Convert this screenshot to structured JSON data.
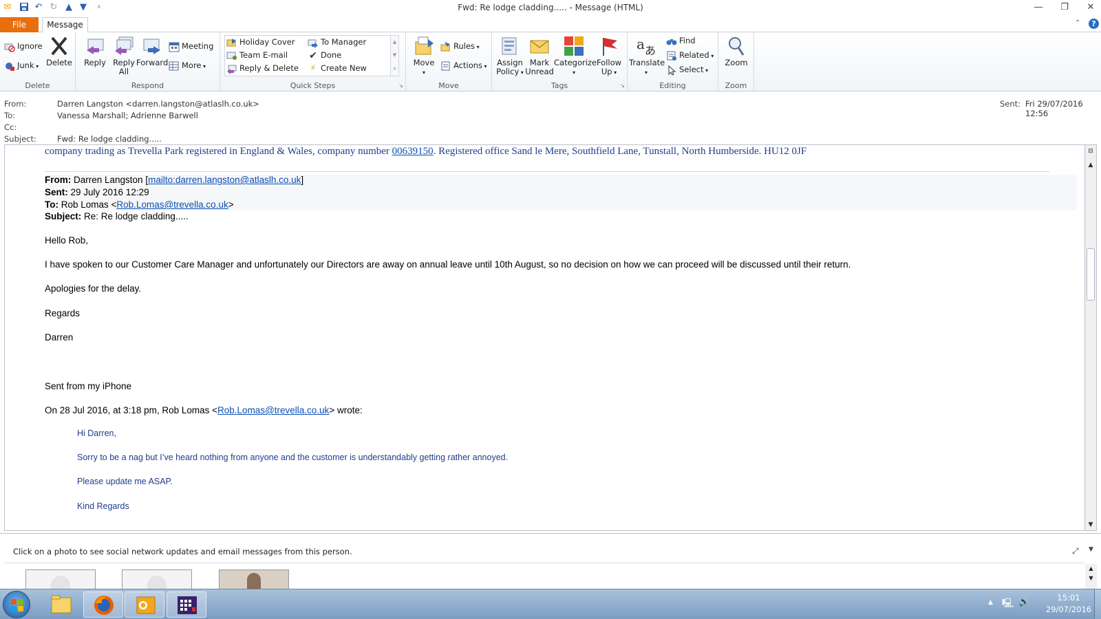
{
  "window": {
    "title": "Fwd: Re lodge cladding.....  -  Message (HTML)"
  },
  "tabs": {
    "file": "File",
    "message": "Message"
  },
  "ribbon": {
    "delete_group": {
      "label": "Delete",
      "ignore": "Ignore",
      "junk": "Junk",
      "delete": "Delete"
    },
    "respond_group": {
      "label": "Respond",
      "reply": "Reply",
      "reply_all_1": "Reply",
      "reply_all_2": "All",
      "forward": "Forward",
      "meeting": "Meeting",
      "more": "More"
    },
    "quicksteps_group": {
      "label": "Quick Steps",
      "items": [
        "Holiday Cover",
        "To Manager",
        "Team E-mail",
        "Done",
        "Reply & Delete",
        "Create New"
      ]
    },
    "move_group": {
      "label": "Move",
      "move": "Move",
      "rules": "Rules",
      "actions": "Actions"
    },
    "tags_group": {
      "label": "Tags",
      "assign_1": "Assign",
      "assign_2": "Policy",
      "mark_1": "Mark",
      "mark_2": "Unread",
      "categorize": "Categorize",
      "follow_1": "Follow",
      "follow_2": "Up"
    },
    "editing_group": {
      "label": "Editing",
      "translate": "Translate",
      "find": "Find",
      "related": "Related",
      "select": "Select"
    },
    "zoom_group": {
      "label": "Zoom",
      "zoom": "Zoom"
    }
  },
  "header": {
    "from_label": "From:",
    "from_value": "Darren Langston <darren.langston@atlaslh.co.uk>",
    "to_label": "To:",
    "to_value": "Vanessa Marshall; Adrienne Barwell",
    "cc_label": "Cc:",
    "cc_value": "",
    "subject_label": "Subject:",
    "subject_value": "Fwd: Re lodge cladding.....",
    "sent_label": "Sent:",
    "sent_value": "Fri 29/07/2016 12:56"
  },
  "body": {
    "footer_line_pre": "company trading as Trevella Park registered in England & Wales, company number ",
    "footer_company_number": "00639150",
    "footer_line_post": ". Registered office Sand le Mere, Southfield Lane, Tunstall, North Humberside. HU12 0JF",
    "fwd_from_label": "From:",
    "fwd_from_name": " Darren Langston [",
    "fwd_from_link": "mailto:darren.langston@atlaslh.co.uk",
    "fwd_from_close": "]",
    "fwd_sent_label": "Sent:",
    "fwd_sent_value": " 29 July 2016 12:29",
    "fwd_to_label": "To:",
    "fwd_to_name": " Rob Lomas <",
    "fwd_to_link": "Rob.Lomas@trevella.co.uk",
    "fwd_to_close": ">",
    "fwd_subject_label": "Subject:",
    "fwd_subject_value": " Re: Re lodge cladding.....",
    "greeting": "Hello Rob,",
    "para1": "I have spoken to our Customer Care Manager and unfortunately our Directors are away on annual leave until 10th August, so no decision on how we can proceed will be discussed until their return.",
    "para2": "Apologies for the delay.",
    "regards": "Regards",
    "signoff": "Darren",
    "sent_from": "Sent from my iPhone",
    "wrote_pre": "On 28 Jul 2016, at 3:18 pm, Rob Lomas <",
    "wrote_link": "Rob.Lomas@trevella.co.uk",
    "wrote_post": "> wrote:",
    "q_greeting": "Hi Darren,",
    "q_para1": "Sorry to be a nag but I’ve heard nothing from anyone and the customer is understandably getting rather annoyed.",
    "q_para2": "Please update me ASAP.",
    "q_regards": "Kind Regards"
  },
  "people_pane": {
    "text": "Click on a photo to see social network updates and email messages from this person."
  },
  "taskbar": {
    "time": "15:01",
    "date": "29/07/2016"
  },
  "colors": {
    "file_tab": "#e86f0e",
    "link": "#0b4db3",
    "quote_text": "#1f3d8a"
  }
}
